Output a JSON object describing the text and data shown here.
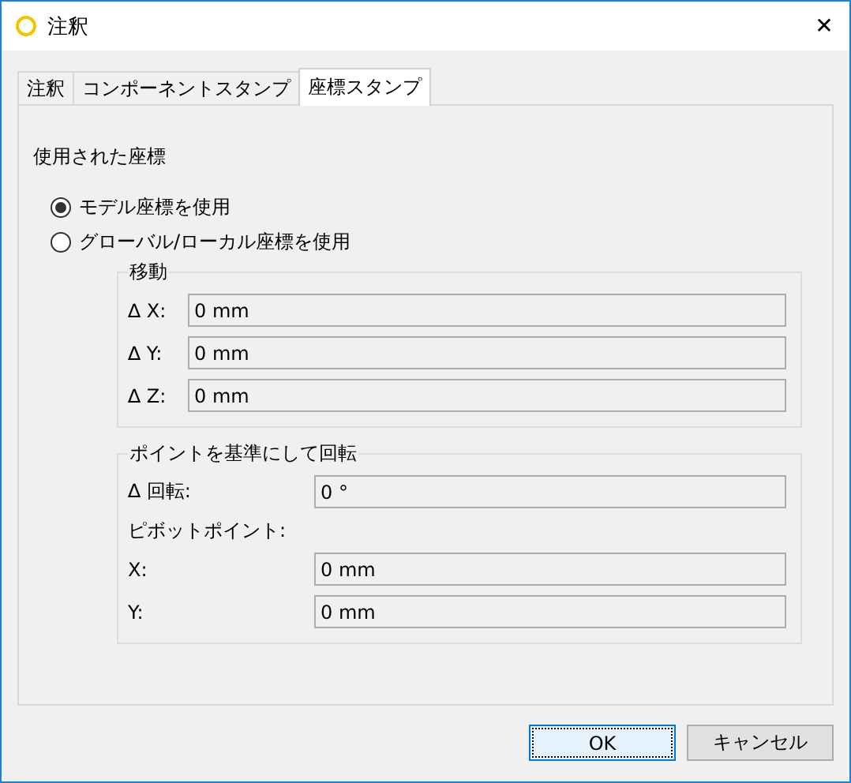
{
  "window": {
    "title": "注釈",
    "close": "✕"
  },
  "tabs": [
    {
      "label": "注釈",
      "selected": false
    },
    {
      "label": "コンポーネントスタンプ",
      "selected": false
    },
    {
      "label": "座標スタンプ",
      "selected": true
    }
  ],
  "section_label": "使用された座標",
  "radios": [
    {
      "label": "モデル座標を使用",
      "selected": true
    },
    {
      "label": "グローバル/ローカル座標を使用",
      "selected": false
    }
  ],
  "groups": [
    {
      "title": "移動",
      "rows": [
        {
          "kind": "field",
          "label": "∆ X:",
          "value": "0 mm",
          "disabled": true
        },
        {
          "kind": "field",
          "label": "∆ Y:",
          "value": "0 mm",
          "disabled": true
        },
        {
          "kind": "field",
          "label": "∆ Z:",
          "value": "0 mm",
          "disabled": true
        }
      ]
    },
    {
      "title": "ポイントを基準にして回転",
      "rows": [
        {
          "kind": "field",
          "label": "∆ 回転:",
          "value": "0 °",
          "disabled": true
        },
        {
          "kind": "heading",
          "label": "ピボットポイント:"
        },
        {
          "kind": "field",
          "label": "X:",
          "value": "0 mm",
          "disabled": true
        },
        {
          "kind": "field",
          "label": "Y:",
          "value": "0 mm",
          "disabled": true
        }
      ]
    }
  ],
  "buttons": [
    {
      "label": "OK",
      "default": true
    },
    {
      "label": "キャンセル",
      "default": false
    }
  ]
}
